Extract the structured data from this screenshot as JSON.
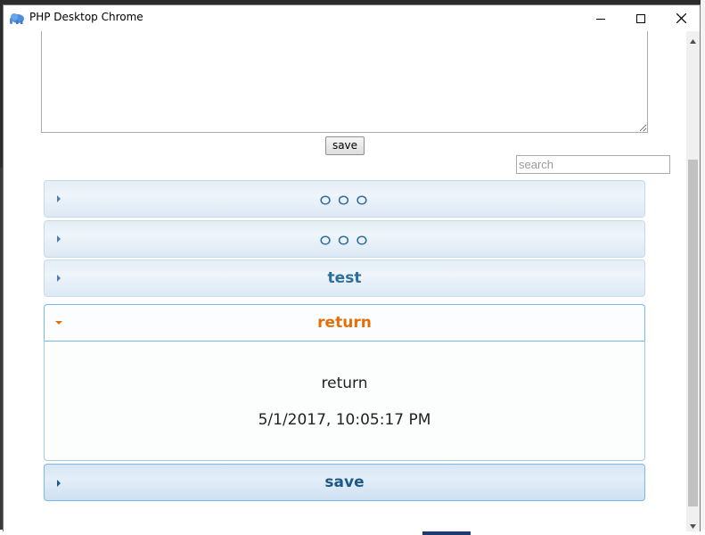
{
  "window": {
    "title": "PHP Desktop Chrome",
    "icon": "elephant-icon",
    "controls": [
      "minimize-icon",
      "maximize-icon",
      "close-icon"
    ]
  },
  "form": {
    "textarea_value": "",
    "save_label": "save",
    "search_placeholder": "search",
    "search_value": ""
  },
  "accordion": {
    "items": [
      {
        "label": "ㅇㅇㅇ",
        "state": "collapsed"
      },
      {
        "label": "ㅇㅇㅇ",
        "state": "collapsed"
      },
      {
        "label": "test",
        "state": "collapsed"
      },
      {
        "label": "return",
        "state": "expanded",
        "content": {
          "text": "return",
          "timestamp": "5/1/2017, 10:05:17 PM"
        }
      },
      {
        "label": "save",
        "state": "collapsed"
      }
    ]
  },
  "colors": {
    "header_text": "#2e6e9e",
    "active_text": "#e17009",
    "save_text": "#1d5987",
    "header_border": "#c5dbec",
    "active_border": "#79b7e7"
  }
}
